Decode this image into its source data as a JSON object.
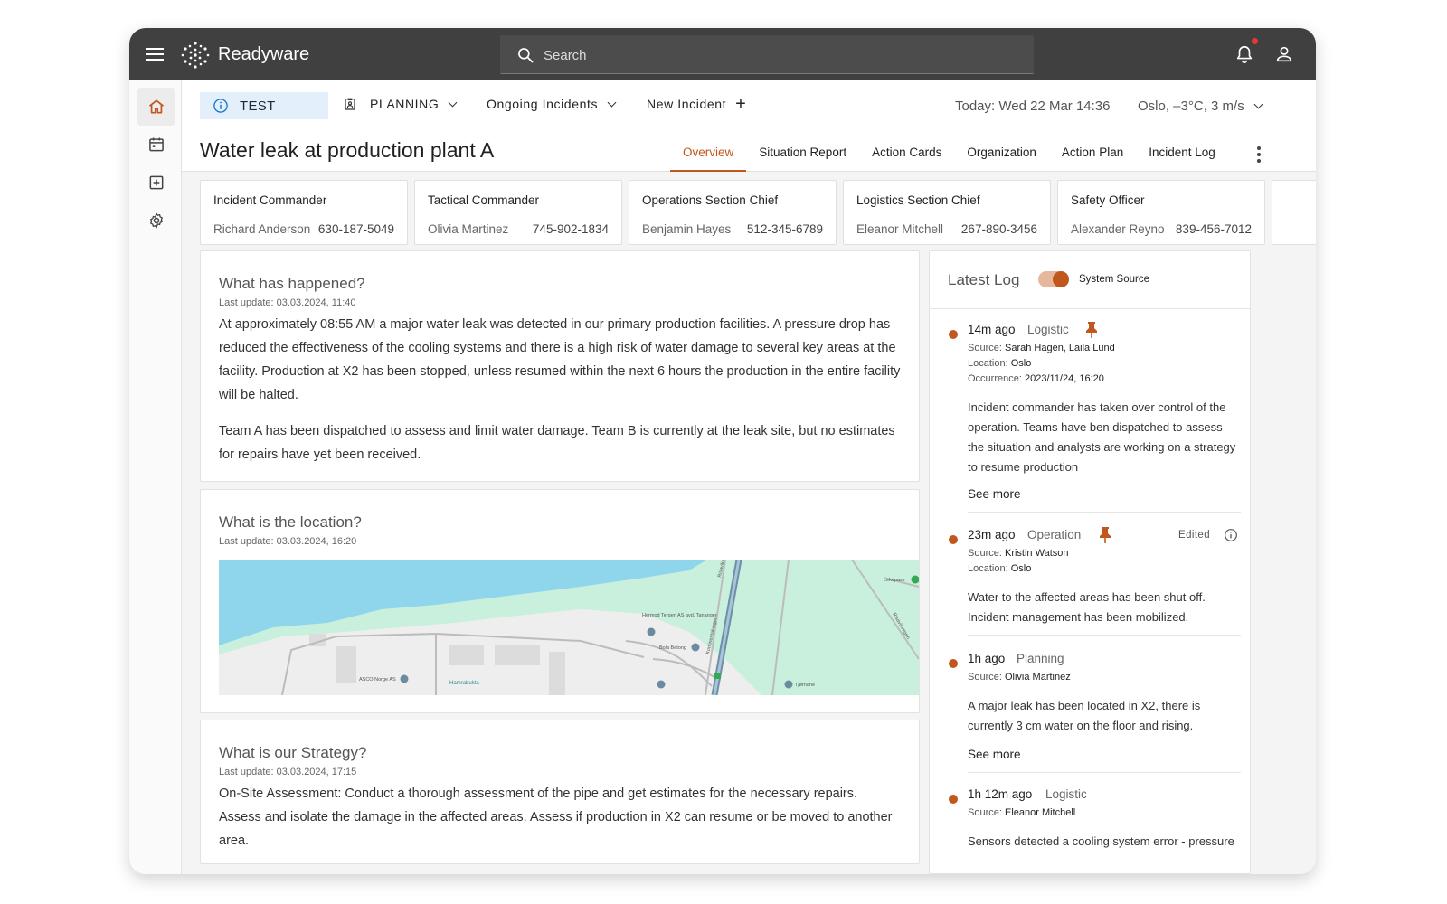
{
  "app": {
    "brand": "Readyware"
  },
  "search": {
    "placeholder": "Search"
  },
  "subnav": {
    "badge": "TEST",
    "planning": "PLANNING",
    "ongoing": "Ongoing Incidents",
    "new_incident": "New Incident",
    "new_incident_symbol": "+",
    "date": "Today: Wed 22 Mar 14:36",
    "weather": "Oslo, –3°C, 3 m/s"
  },
  "incident": {
    "title": "Water leak at production plant A"
  },
  "tabs": [
    {
      "label": "Overview",
      "active": true
    },
    {
      "label": "Situation Report",
      "active": false
    },
    {
      "label": "Action Cards",
      "active": false
    },
    {
      "label": "Organization",
      "active": false
    },
    {
      "label": "Action Plan",
      "active": false
    },
    {
      "label": "Incident Log",
      "active": false
    }
  ],
  "roles": [
    {
      "title": "Incident Commander",
      "name": "Richard Anderson",
      "phone": "630-187-5049"
    },
    {
      "title": "Tactical Commander",
      "name": "Olivia Martinez",
      "phone": "745-902-1834"
    },
    {
      "title": "Operations Section Chief",
      "name": "Benjamin Hayes",
      "phone": "512-345-6789"
    },
    {
      "title": "Logistics Section Chief",
      "name": "Eleanor Mitchell",
      "phone": "267-890-3456"
    },
    {
      "title": "Safety Officer",
      "name": "Alexander Reyno",
      "phone": "839-456-7012"
    }
  ],
  "sections": {
    "happened": {
      "title": "What has happened?",
      "updated": "Last update: 03.03.2024, 11:40",
      "p1": "At approximately 08:55 AM a major water leak was detected in our primary production facilities. A pressure drop has reduced the effectiveness of the cooling systems and there is a high risk of water damage to several key areas at the facility. Production at X2 has been stopped, unless resumed within the next 6 hours the production in the entire facility will be halted.",
      "p2": "Team A has been dispatched to assess and limit water damage. Team B is currently at the leak site, but no estimates for repairs have yet been received."
    },
    "location": {
      "title": "What is the location?",
      "updated": "Last update: 03.03.2024, 16:20",
      "map_labels": {
        "place1": "Hermod Tergen AS avd. Tananger",
        "place2": "Bola Betong",
        "place3": "ASCO Norge AS",
        "place4": "Hamrabukta",
        "place5": "Lekepass",
        "place6": "Kontinentalvegen",
        "place7": "Risavika",
        "place8": "Tjørnane",
        "place9": "Risavikvegen"
      }
    },
    "strategy": {
      "title": "What is our Strategy?",
      "updated": "Last update: 03.03.2024, 17:15",
      "p1": "On-Site Assessment: Conduct a thorough assessment of the pipe and get estimates for the necessary repairs. Assess and isolate the damage in the affected areas. Assess if production in X2 can resume or be moved to another area."
    }
  },
  "log": {
    "title": "Latest Log",
    "toggle_label": "System Source",
    "toggle_on": true,
    "source_label": "Source:",
    "location_label": "Location:",
    "occurrence_label": "Occurrence:",
    "see_more": "See more",
    "edited_label": "Edited",
    "entries": [
      {
        "time": "14m ago",
        "category": "Logistic",
        "pinned": true,
        "source": "Sarah Hagen, Laila Lund",
        "location": "Oslo",
        "occurrence": "2023/11/24, 16:20",
        "text": "Incident commander has taken over control of the operation. Teams have ben dispatched to assess the situation and analysts are working on a strategy to resume production"
      },
      {
        "time": "23m ago",
        "category": "Operation",
        "pinned": true,
        "edited": true,
        "source": "Kristin Watson",
        "location": "Oslo",
        "text": "Water to the affected areas has been shut off. Incident management has been mobilized."
      },
      {
        "time": "1h ago",
        "category": "Planning",
        "pinned": false,
        "source": "Olivia Martinez",
        "text": "A major leak has been located in X2, there is currently 3 cm water on the floor and rising."
      },
      {
        "time": "1h 12m ago",
        "category": "Logistic",
        "pinned": false,
        "source": "Eleanor Mitchell",
        "text": "Sensors detected a cooling system error - pressure"
      }
    ]
  },
  "colors": {
    "accent": "#c0571c",
    "topbar": "#404040",
    "badge_bg": "#e3f0fb",
    "water": "#8fd6ec",
    "park": "#c9f0dc"
  },
  "icons": {
    "menu": "menu-icon",
    "logo": "readyware-logo-icon",
    "search": "search-icon",
    "bell": "bell-icon",
    "user": "user-icon",
    "home": "home-icon",
    "calendar": "calendar-icon",
    "add": "add-box-icon",
    "settings": "gear-icon",
    "info": "info-icon",
    "clipboard": "clipboard-icon",
    "pin": "pin-icon"
  }
}
